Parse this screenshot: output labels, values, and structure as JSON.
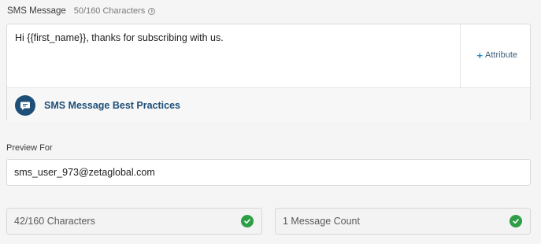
{
  "sms": {
    "title": "SMS Message",
    "char_limit_text": "50/160 Characters",
    "message_text": "Hi {{first_name}}, thanks for subscribing with us.",
    "attribute_label": "Attribute",
    "best_practices_label": "SMS Message Best Practices"
  },
  "preview": {
    "label": "Preview For",
    "value": "sms_user_973@zetaglobal.com"
  },
  "stats": {
    "characters": "42/160 Characters",
    "message_count": "1 Message Count"
  },
  "colors": {
    "accent": "#1e4f78",
    "plus": "#1f8ad6",
    "success": "#2e9e46"
  },
  "icons": [
    "info-icon",
    "plus-icon",
    "chat-bubble-icon",
    "check-circle-icon"
  ]
}
